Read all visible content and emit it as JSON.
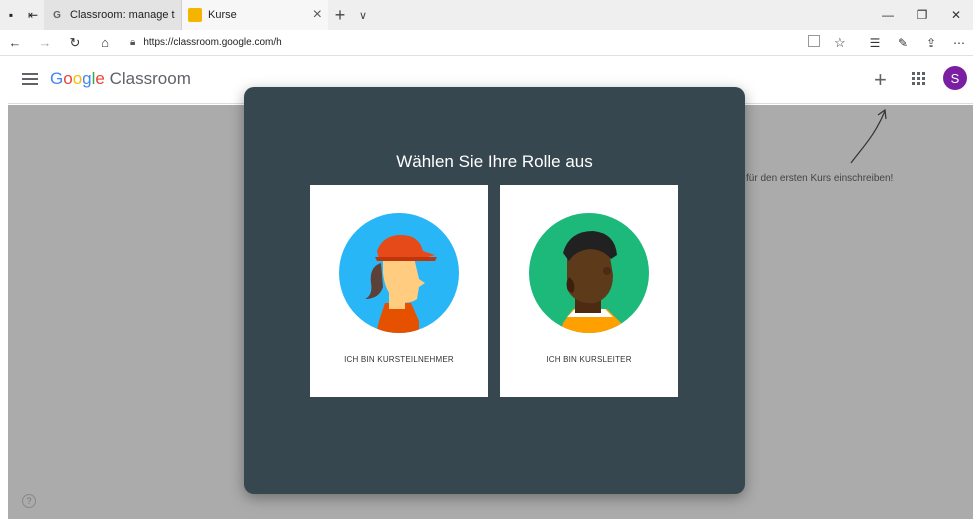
{
  "browser": {
    "tabs": [
      {
        "title": "Classroom: manage teachin"
      },
      {
        "title": "Kurse"
      }
    ],
    "url": "https://classroom.google.com/h"
  },
  "app": {
    "brand_google": "Google",
    "brand_product": "Classroom",
    "avatar_letter": "S"
  },
  "page": {
    "hint_text": "für den ersten Kurs einschreiben!"
  },
  "dialog": {
    "title": "Wählen Sie Ihre Rolle aus",
    "student_label": "ICH BIN KURSTEILNEHMER",
    "teacher_label": "ICH BIN KURSLEITER"
  },
  "colors": {
    "dialog_bg": "#37474f",
    "student_circle": "#29b6f6",
    "teacher_circle": "#1db97a",
    "avatar_bg": "#7b1fa2"
  }
}
